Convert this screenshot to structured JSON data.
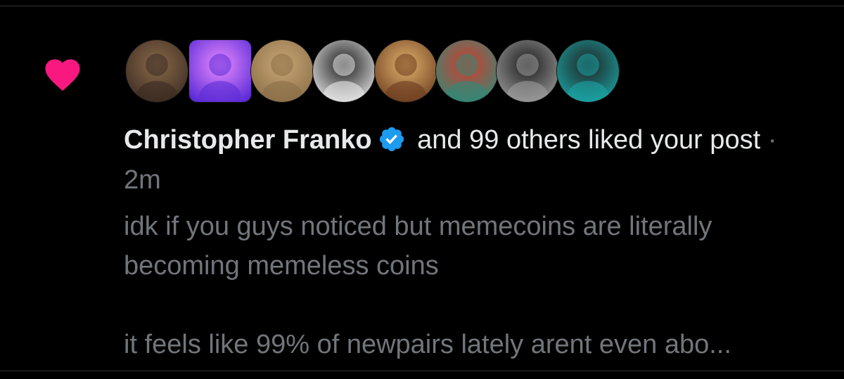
{
  "notification": {
    "type": "like",
    "heart_icon": "heart-icon",
    "heart_color": "#f91880",
    "avatars": [
      {
        "name": "avatar-wizard",
        "colors": [
          "#3a2a22",
          "#8a6a4a"
        ]
      },
      {
        "name": "avatar-purple-logo",
        "colors": [
          "#5b2bd6",
          "#e98bff"
        ]
      },
      {
        "name": "avatar-tan-statue",
        "colors": [
          "#8a6e47",
          "#c9a776"
        ]
      },
      {
        "name": "avatar-anime-cap",
        "colors": [
          "#e9e9ea",
          "#1b1b1b"
        ]
      },
      {
        "name": "avatar-anime-blonde",
        "colors": [
          "#6b3b1e",
          "#e0b36c"
        ]
      },
      {
        "name": "avatar-red-landscape",
        "colors": [
          "#2d8b79",
          "#d63b2c"
        ]
      },
      {
        "name": "avatar-mirror-selfie",
        "colors": [
          "#9c9c9c",
          "#1c1c1c"
        ]
      },
      {
        "name": "avatar-dark-girl",
        "colors": [
          "#1aa5a5",
          "#222"
        ]
      }
    ],
    "actor_name": "Christopher Franko",
    "verified_icon": "verified-badge-icon",
    "verified_color": "#1d9bf0",
    "action_text": " and 99 others liked your post",
    "separator": " · ",
    "time": "2m",
    "post_lines": [
      "idk if you guys noticed but memecoins are literally",
      "becoming memeless coins",
      "it feels like 99% of newpairs lately arent even abo..."
    ]
  }
}
